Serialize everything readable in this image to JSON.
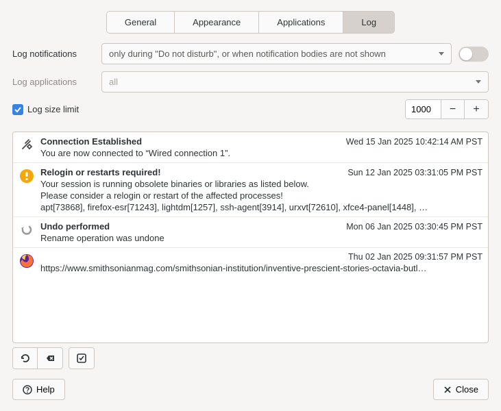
{
  "tabs": {
    "general": "General",
    "appearance": "Appearance",
    "applications": "Applications",
    "log": "Log"
  },
  "settings": {
    "log_notifications_label": "Log notifications",
    "log_notifications_value": "only during \"Do not disturb\", or when notification bodies are not shown",
    "log_applications_label": "Log applications",
    "log_applications_value": "all",
    "log_size_limit_label": "Log size limit",
    "log_size_limit_value": "1000"
  },
  "log_entries": [
    {
      "icon": "plug",
      "title": "Connection Established",
      "time": "Wed 15 Jan 2025 10:42:14 AM PST",
      "lines": [
        "You are now connected to “Wired connection 1”."
      ]
    },
    {
      "icon": "warning",
      "title": "Relogin or restarts required!",
      "time": "Sun 12 Jan 2025 03:31:05 PM PST",
      "lines": [
        "Your session is running obsolete binaries or libraries as listed below."
      ],
      "emph": "Please consider a relogin or restart of the affected processes!",
      "mono": "apt[73868], firefox-esr[71243], lightdm[1257], ssh-agent[3914], urxvt[72610], xfce4-panel[1448], …"
    },
    {
      "icon": "undo",
      "title": "Undo performed",
      "time": "Mon 06 Jan 2025 03:30:45 PM PST",
      "lines": [
        "Rename operation was undone"
      ]
    },
    {
      "icon": "firefox",
      "title": "",
      "time": "Thu 02 Jan 2025 09:31:57 PM PST",
      "lines": [
        "https://www.smithsonianmag.com/smithsonian-institution/inventive-prescient-stories-octavia-butl…"
      ]
    }
  ],
  "footer": {
    "help": "Help",
    "close": "Close"
  }
}
